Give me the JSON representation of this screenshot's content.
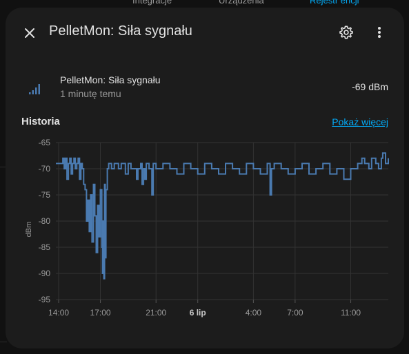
{
  "background_tabs": [
    "Integracje",
    "Urządzenia",
    "Rejestr encji"
  ],
  "dialog": {
    "title": "PelletMon: Siła sygnału",
    "close_icon": "close-icon",
    "settings_icon": "gear-icon",
    "menu_icon": "dots-vertical-icon"
  },
  "entity": {
    "icon": "signal-strength-icon",
    "name": "PelletMon: Siła sygnału",
    "last_changed": "1 minutę temu",
    "state": "-69 dBm"
  },
  "history": {
    "title": "Historia",
    "show_more": "Pokaż więcej"
  },
  "colors": {
    "accent": "#03a9f4",
    "series": "#4a7ab0",
    "surface": "#1c1c1c"
  },
  "chart_data": {
    "type": "line",
    "ylabel": "dBm",
    "ylim": [
      -95,
      -65
    ],
    "y_ticks": [
      "-65",
      "-70",
      "-75",
      "-80",
      "-85",
      "-90",
      "-95"
    ],
    "x_ticks": [
      "14:00",
      "17:00",
      "21:00",
      "6 lip",
      "4:00",
      "7:00",
      "11:00"
    ],
    "x_tick_bold": [
      false,
      false,
      false,
      true,
      false,
      false,
      false
    ],
    "x_tick_hours": [
      0,
      3,
      7,
      10,
      14,
      17,
      21
    ],
    "x_range_hours": [
      -0.2,
      23.7
    ],
    "grid": true,
    "series": [
      {
        "points": [
          [
            -0.2,
            -69
          ],
          [
            0.1,
            -69
          ],
          [
            0.3,
            -68
          ],
          [
            0.4,
            -70
          ],
          [
            0.5,
            -68
          ],
          [
            0.6,
            -72
          ],
          [
            0.7,
            -69
          ],
          [
            0.8,
            -68
          ],
          [
            0.9,
            -71
          ],
          [
            1.0,
            -69
          ],
          [
            1.1,
            -68
          ],
          [
            1.2,
            -70
          ],
          [
            1.3,
            -69
          ],
          [
            1.4,
            -68
          ],
          [
            1.5,
            -72
          ],
          [
            1.6,
            -69
          ],
          [
            1.7,
            -70
          ],
          [
            1.8,
            -73
          ],
          [
            1.9,
            -74
          ],
          [
            2.0,
            -80
          ],
          [
            2.1,
            -76
          ],
          [
            2.2,
            -82
          ],
          [
            2.3,
            -75
          ],
          [
            2.4,
            -84
          ],
          [
            2.5,
            -73
          ],
          [
            2.6,
            -79
          ],
          [
            2.7,
            -86
          ],
          [
            2.8,
            -77
          ],
          [
            2.9,
            -83
          ],
          [
            3.0,
            -74
          ],
          [
            3.1,
            -85
          ],
          [
            3.15,
            -90
          ],
          [
            3.2,
            -80
          ],
          [
            3.25,
            -91
          ],
          [
            3.3,
            -73
          ],
          [
            3.35,
            -87
          ],
          [
            3.4,
            -74
          ],
          [
            3.5,
            -70
          ],
          [
            3.6,
            -69
          ],
          [
            3.8,
            -70
          ],
          [
            4.0,
            -69
          ],
          [
            4.3,
            -70
          ],
          [
            4.5,
            -69
          ],
          [
            4.8,
            -71
          ],
          [
            5.0,
            -69
          ],
          [
            5.2,
            -70
          ],
          [
            5.5,
            -70
          ],
          [
            5.6,
            -72
          ],
          [
            5.7,
            -70
          ],
          [
            5.9,
            -69
          ],
          [
            6.0,
            -73
          ],
          [
            6.1,
            -70
          ],
          [
            6.2,
            -72
          ],
          [
            6.3,
            -69
          ],
          [
            6.5,
            -70
          ],
          [
            6.7,
            -75
          ],
          [
            6.8,
            -69
          ],
          [
            7.0,
            -70
          ],
          [
            7.5,
            -69
          ],
          [
            8.0,
            -70
          ],
          [
            8.5,
            -71
          ],
          [
            9.0,
            -69
          ],
          [
            9.5,
            -70
          ],
          [
            10.0,
            -71
          ],
          [
            10.5,
            -69
          ],
          [
            11.0,
            -70
          ],
          [
            11.5,
            -71
          ],
          [
            12.0,
            -69
          ],
          [
            12.5,
            -70
          ],
          [
            13.0,
            -71
          ],
          [
            13.5,
            -69
          ],
          [
            14.0,
            -70
          ],
          [
            14.5,
            -71
          ],
          [
            15.0,
            -69
          ],
          [
            15.2,
            -75
          ],
          [
            15.3,
            -70
          ],
          [
            15.5,
            -69
          ],
          [
            16.0,
            -70
          ],
          [
            16.5,
            -71
          ],
          [
            17.0,
            -70
          ],
          [
            17.5,
            -69
          ],
          [
            18.0,
            -71
          ],
          [
            18.5,
            -70
          ],
          [
            19.0,
            -69
          ],
          [
            19.5,
            -71
          ],
          [
            20.0,
            -70
          ],
          [
            20.5,
            -72
          ],
          [
            21.0,
            -70
          ],
          [
            21.5,
            -69
          ],
          [
            21.8,
            -68
          ],
          [
            22.0,
            -69
          ],
          [
            22.3,
            -70
          ],
          [
            22.5,
            -68
          ],
          [
            22.8,
            -69
          ],
          [
            23.0,
            -70
          ],
          [
            23.2,
            -68
          ],
          [
            23.3,
            -67
          ],
          [
            23.5,
            -69
          ],
          [
            23.7,
            -68
          ]
        ]
      }
    ]
  }
}
